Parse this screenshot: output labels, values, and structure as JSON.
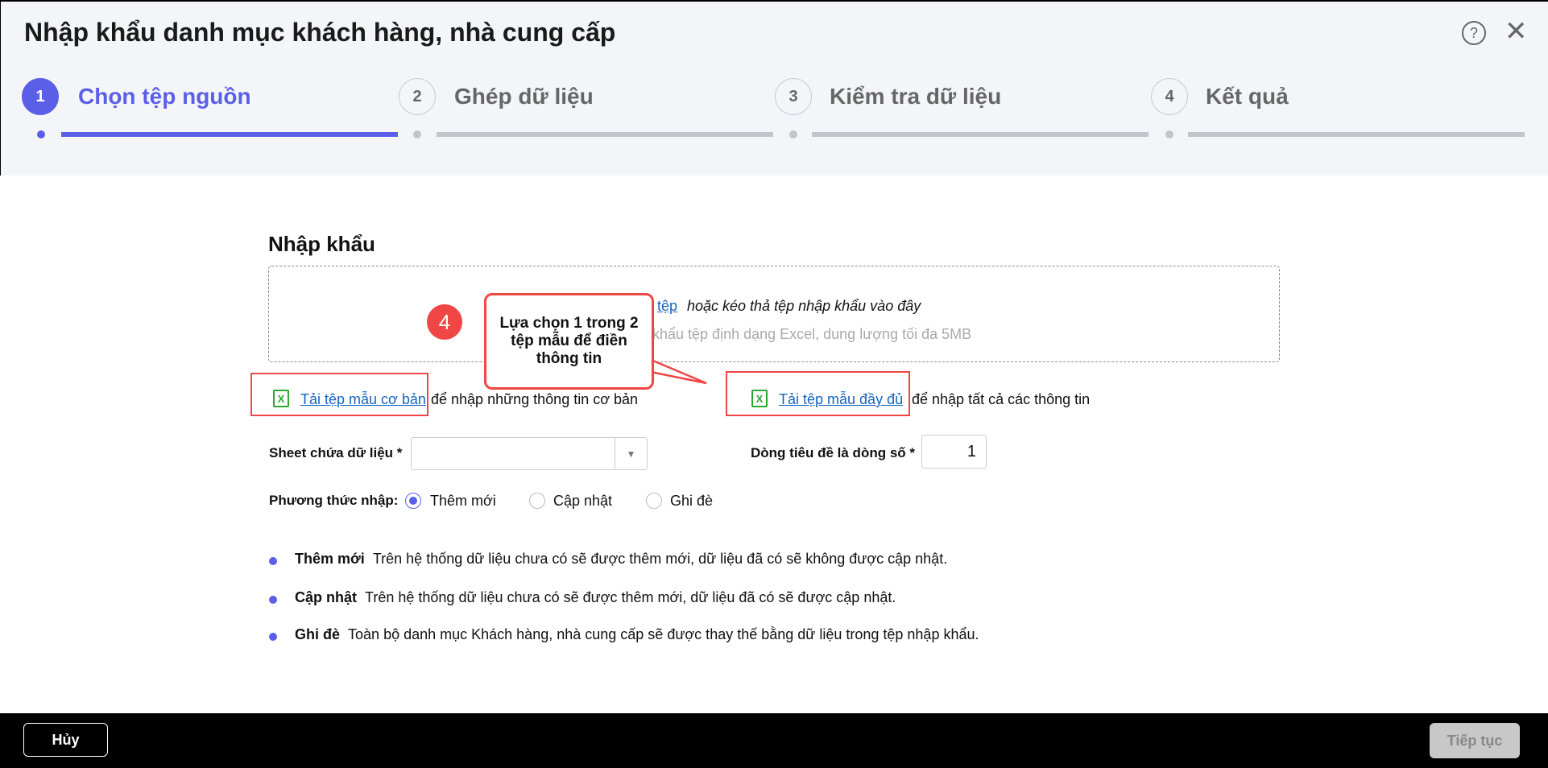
{
  "header": {
    "title": "Nhập khẩu danh mục khách hàng, nhà cung cấp",
    "help_icon": "question-circle",
    "close_icon": "x"
  },
  "steps": [
    {
      "number": "1",
      "label": "Chọn tệp nguồn",
      "active": true
    },
    {
      "number": "2",
      "label": "Ghép dữ liệu",
      "active": false
    },
    {
      "number": "3",
      "label": "Kiểm tra dữ liệu",
      "active": false
    },
    {
      "number": "4",
      "label": "Kết quả",
      "active": false
    }
  ],
  "main": {
    "heading": "Nhập khẩu",
    "dropzone": {
      "link": "tệp",
      "line1": "hoặc kéo thả tệp nhập khẩu vào đây",
      "line2": "khẩu tệp định dạng Excel, dung lượng tối đa 5MB"
    },
    "template_basic": {
      "link": "Tải tệp mẫu cơ bản",
      "text": "để nhập những thông tin cơ bản"
    },
    "template_full": {
      "link": "Tải tệp mẫu đầy đủ",
      "text": "để nhập tất cả các thông tin"
    },
    "sheet": {
      "label": "Sheet chứa dữ liệu *",
      "value": ""
    },
    "header_row": {
      "label": "Dòng tiêu đề là dòng số *",
      "value": "1"
    },
    "method": {
      "label": "Phương thức nhập:",
      "options": [
        "Thêm mới",
        "Cập nhật",
        "Ghi đè"
      ],
      "selected": "Thêm mới"
    },
    "notes": [
      {
        "title": "Thêm mới",
        "text": "Trên hệ thống dữ liệu chưa có sẽ được thêm mới, dữ liệu đã có sẽ không được cập nhật."
      },
      {
        "title": "Cập nhật",
        "text": "Trên hệ thống dữ liệu chưa có sẽ được thêm mới, dữ liệu đã có sẽ được cập nhật."
      },
      {
        "title": "Ghi đè",
        "text": "Toàn bộ danh mục Khách hàng, nhà cung cấp sẽ được thay thế bằng dữ liệu trong tệp nhập khẩu."
      }
    ]
  },
  "annotation": {
    "number": "4",
    "callout": "Lựa chọn 1 trong 2 tệp mẫu để điền thông tin"
  },
  "footer": {
    "cancel": "Hủy",
    "next": "Tiếp tục"
  },
  "colors": {
    "accent": "#5b5fe8",
    "annotation": "#f04646",
    "excel": "#2ea62e"
  }
}
